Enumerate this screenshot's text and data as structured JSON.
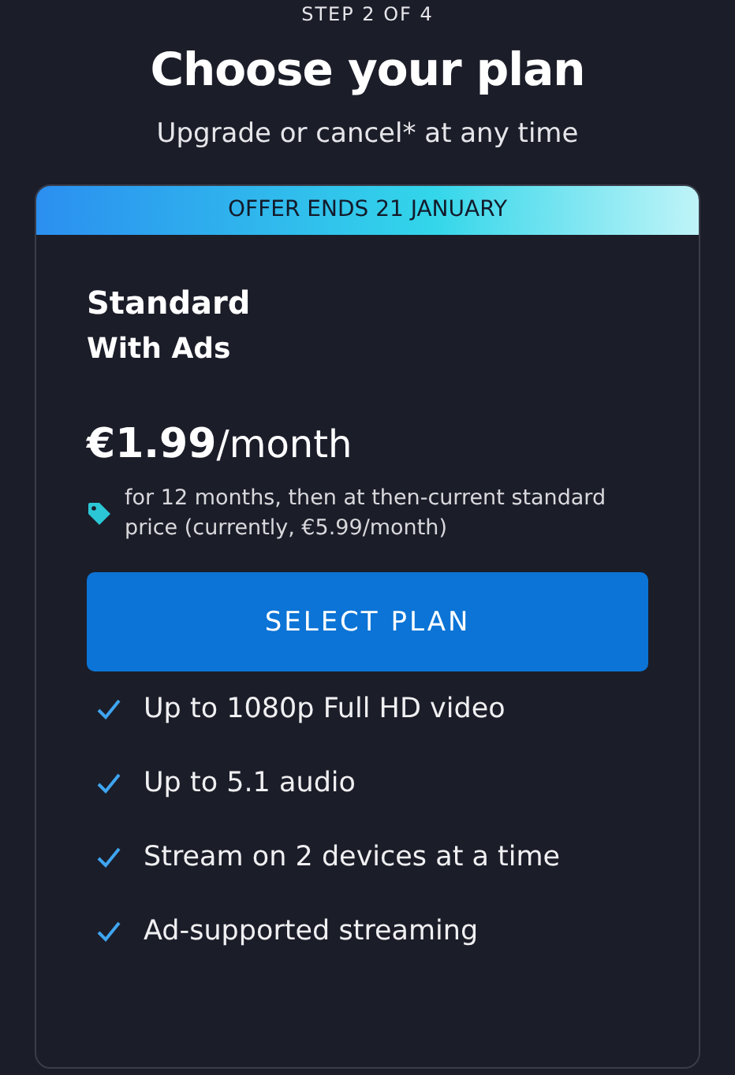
{
  "step": "STEP 2 OF 4",
  "title": "Choose your plan",
  "subtitle": "Upgrade or cancel* at any time",
  "plan": {
    "banner": "OFFER ENDS 21 JANUARY",
    "name": "Standard",
    "tier": "With Ads",
    "price": "€1.99",
    "period": "/month",
    "note": "for 12 months, then at then-current standard price (currently, €5.99/month)",
    "button": "SELECT PLAN",
    "features": [
      {
        "text": "Up to 1080p Full HD video",
        "included": true
      },
      {
        "text": "Up to 5.1 audio",
        "included": true
      },
      {
        "text": "Stream on 2 devices at a time",
        "included": true
      },
      {
        "text": "Ad-supported streaming",
        "included": true
      }
    ]
  }
}
